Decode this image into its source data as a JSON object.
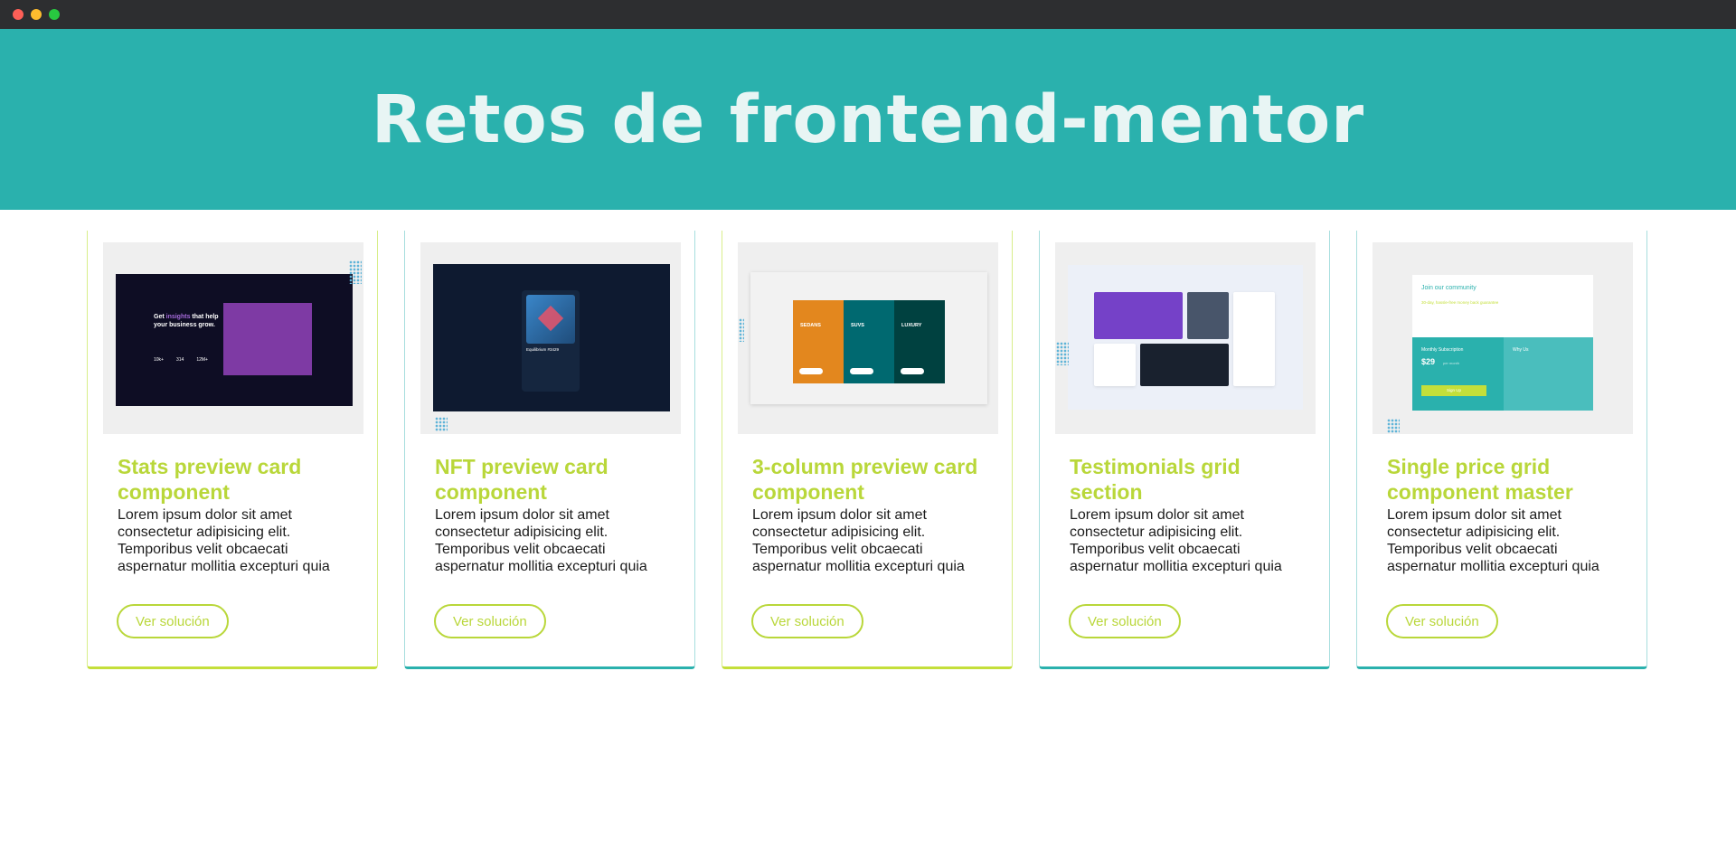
{
  "header": {
    "title": "Retos de frontend-mentor"
  },
  "cards": [
    {
      "title": "Stats preview card component",
      "text": "Lorem ipsum dolor sit amet consectetur adipisicing elit. Temporibus velit obcaecati aspernatur mollitia excepturi quia",
      "button": "Ver solución",
      "thumb": {
        "heading_a": "Get ",
        "heading_accent": "insights",
        "heading_b": " that help your business grow.",
        "stats": [
          "10k+",
          "314",
          "12M+"
        ]
      }
    },
    {
      "title": "NFT preview card component",
      "text": "Lorem ipsum dolor sit amet consectetur adipisicing elit. Temporibus velit obcaecati aspernatur mollitia excepturi quia",
      "button": "Ver solución",
      "thumb": {
        "nft_title": "Equilibrium #3429"
      }
    },
    {
      "title": "3-column preview card component",
      "text": "Lorem ipsum dolor sit amet consectetur adipisicing elit. Temporibus velit obcaecati aspernatur mollitia excepturi quia",
      "button": "Ver solución",
      "thumb": {
        "columns": [
          "SEDANS",
          "SUVS",
          "LUXURY"
        ]
      }
    },
    {
      "title": "Testimonials grid section",
      "text": "Lorem ipsum dolor sit amet consectetur adipisicing elit. Temporibus velit obcaecati aspernatur mollitia excepturi quia",
      "button": "Ver solución",
      "thumb": {}
    },
    {
      "title": "Single price grid component master",
      "text": "Lorem ipsum dolor sit amet consectetur adipisicing elit. Temporibus velit obcaecati aspernatur mollitia excepturi quia",
      "button": "Ver solución",
      "thumb": {
        "join": "Join our community",
        "guarantee": "30-day, hassle-free money back guarantee",
        "monthly": "Monthly Subscription",
        "price": "$29",
        "per": "per month",
        "signup": "Sign Up",
        "why": "Why Us"
      }
    }
  ],
  "colors": {
    "header_bg": "#2ab1ad",
    "accent_lime": "#b9d73a",
    "accent_teal": "#2ab1ad"
  }
}
